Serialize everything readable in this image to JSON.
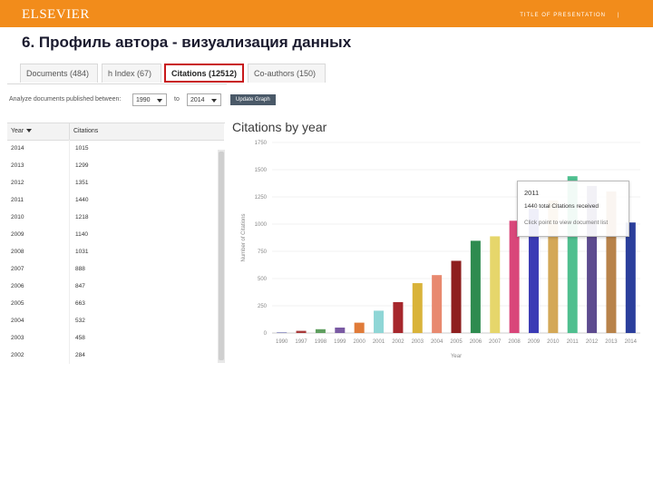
{
  "header": {
    "logo": "ELSEVIER",
    "presentation_title": "TITLE OF PRESENTATION",
    "page_marker": "|"
  },
  "slide_title": "6. Профиль автора - визуализация данных",
  "tabs": [
    {
      "label": "Documents (484)",
      "active": false
    },
    {
      "label": "h Index (67)",
      "active": false
    },
    {
      "label": "Citations (12512)",
      "active": true
    },
    {
      "label": "Co-authors (150)",
      "active": false
    }
  ],
  "filter": {
    "label": "Analyze documents published between:",
    "from_value": "1990",
    "to_label": "to",
    "to_value": "2014",
    "button_label": "Update Graph"
  },
  "table": {
    "headers": [
      "Year",
      "Citations"
    ],
    "rows": [
      [
        "2014",
        "1015"
      ],
      [
        "2013",
        "1299"
      ],
      [
        "2012",
        "1351"
      ],
      [
        "2011",
        "1440"
      ],
      [
        "2010",
        "1218"
      ],
      [
        "2009",
        "1140"
      ],
      [
        "2008",
        "1031"
      ],
      [
        "2007",
        "888"
      ],
      [
        "2006",
        "847"
      ],
      [
        "2005",
        "663"
      ],
      [
        "2004",
        "532"
      ],
      [
        "2003",
        "458"
      ],
      [
        "2002",
        "284"
      ]
    ]
  },
  "chart_data": {
    "type": "bar",
    "title": "Citations by year",
    "xlabel": "Year",
    "ylabel": "Number of Citations",
    "ylim": [
      0,
      1750
    ],
    "yticks": [
      0,
      250,
      500,
      750,
      1000,
      1250,
      1500,
      1750
    ],
    "categories": [
      "1990",
      "1997",
      "1998",
      "1999",
      "2000",
      "2001",
      "2002",
      "2003",
      "2004",
      "2005",
      "2006",
      "2007",
      "2008",
      "2009",
      "2010",
      "2011",
      "2012",
      "2013",
      "2014"
    ],
    "values": [
      5,
      20,
      35,
      50,
      95,
      205,
      284,
      458,
      532,
      663,
      847,
      888,
      1031,
      1140,
      1218,
      1440,
      1351,
      1299,
      1015
    ],
    "colors": [
      "#5b5ea6",
      "#a93a3a",
      "#5f9f5f",
      "#7a5aa3",
      "#e07b39",
      "#8fd6d6",
      "#a6272c",
      "#d9b33a",
      "#e8896f",
      "#8e1f1f",
      "#2e8b4f",
      "#e6d66b",
      "#d9467a",
      "#3b3bb5",
      "#d4a857",
      "#4fbf8f",
      "#5d4b8f",
      "#b8834a",
      "#2b3f9c"
    ]
  },
  "tooltip": {
    "year": "2011",
    "text": "1440 total Citations received",
    "hint": "Click point to view document list"
  }
}
